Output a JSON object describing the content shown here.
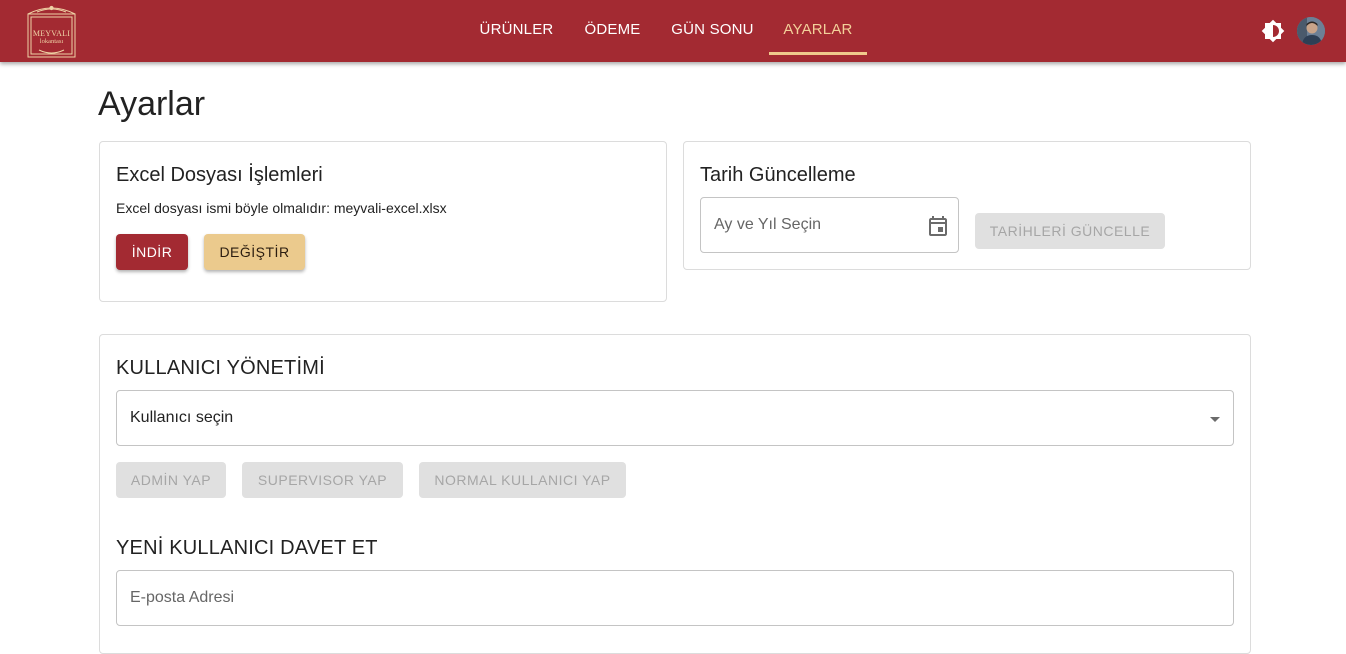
{
  "brand": {
    "logo_line1": "MEYVALI",
    "logo_line2": "lokantası"
  },
  "nav": {
    "tabs": [
      {
        "label": "ÜRÜNLER"
      },
      {
        "label": "ÖDEME"
      },
      {
        "label": "GÜN SONU"
      },
      {
        "label": "AYARLAR",
        "active": true
      }
    ],
    "theme_icon": "brightness-icon",
    "avatar_icon": "user-avatar"
  },
  "page": {
    "title": "Ayarlar"
  },
  "excel_card": {
    "title": "Excel Dosyası İşlemleri",
    "description": "Excel dosyası ismi böyle olmalıdır: meyvali-excel.xlsx",
    "download_label": "İNDİR",
    "change_label": "DEĞİŞTİR"
  },
  "date_card": {
    "title": "Tarih Güncelleme",
    "date_placeholder": "Ay ve Yıl Seçin",
    "calendar_icon": "calendar-icon",
    "update_label": "TARİHLERİ GÜNCELLE"
  },
  "user_management": {
    "title": "KULLANICI YÖNETİMİ",
    "select_placeholder": "Kullanıcı seçin",
    "dropdown_icon": "arrow-drop-down-icon",
    "make_admin_label": "ADMİN YAP",
    "make_supervisor_label": "SUPERVISOR YAP",
    "make_normal_label": "NORMAL KULLANICI YAP",
    "invite_title": "YENİ KULLANICI DAVET ET",
    "email_placeholder": "E-posta Adresi"
  },
  "colors": {
    "primary": "#a32a32",
    "secondary": "#ebca8d",
    "active_tab": "#f3d09a",
    "disabled_bg": "#e0e0e0",
    "disabled_text": "#a6a6a6"
  }
}
